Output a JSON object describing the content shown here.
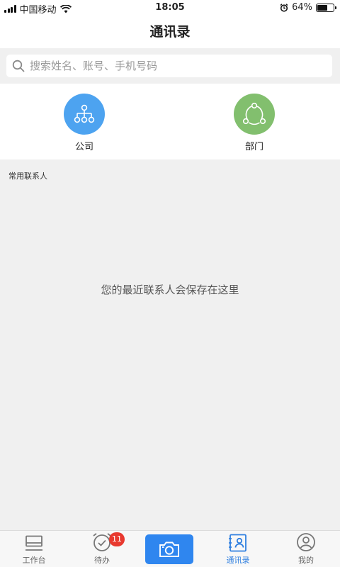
{
  "status_bar": {
    "carrier": "中国移动",
    "time": "18:05",
    "battery_percent": "64%",
    "battery_level": 0.64,
    "icons": [
      "signal-icon",
      "wifi-icon",
      "alarm-icon",
      "battery-icon"
    ]
  },
  "nav": {
    "title": "通讯录"
  },
  "search": {
    "placeholder": "搜索姓名、账号、手机号码",
    "value": "",
    "icon": "search-icon"
  },
  "quick_entries": [
    {
      "label": "公司",
      "icon": "org-chart-icon",
      "color": "#4da3f0"
    },
    {
      "label": "部门",
      "icon": "department-icon",
      "color": "#82bf6e"
    }
  ],
  "section_label": "常用联系人",
  "empty_message": "您的最近联系人会保存在这里",
  "tabbar": {
    "tabs": [
      {
        "label": "工作台",
        "icon": "workbench-icon",
        "active": false
      },
      {
        "label": "待办",
        "icon": "alarm-clock-icon",
        "active": false,
        "badge": "11"
      },
      {
        "label": "",
        "icon": "camera-icon",
        "active": false,
        "color": "#2f86ef"
      },
      {
        "label": "通讯录",
        "icon": "contacts-icon",
        "active": true
      },
      {
        "label": "我的",
        "icon": "profile-icon",
        "active": false
      }
    ],
    "active_color": "#2f7fe0"
  }
}
